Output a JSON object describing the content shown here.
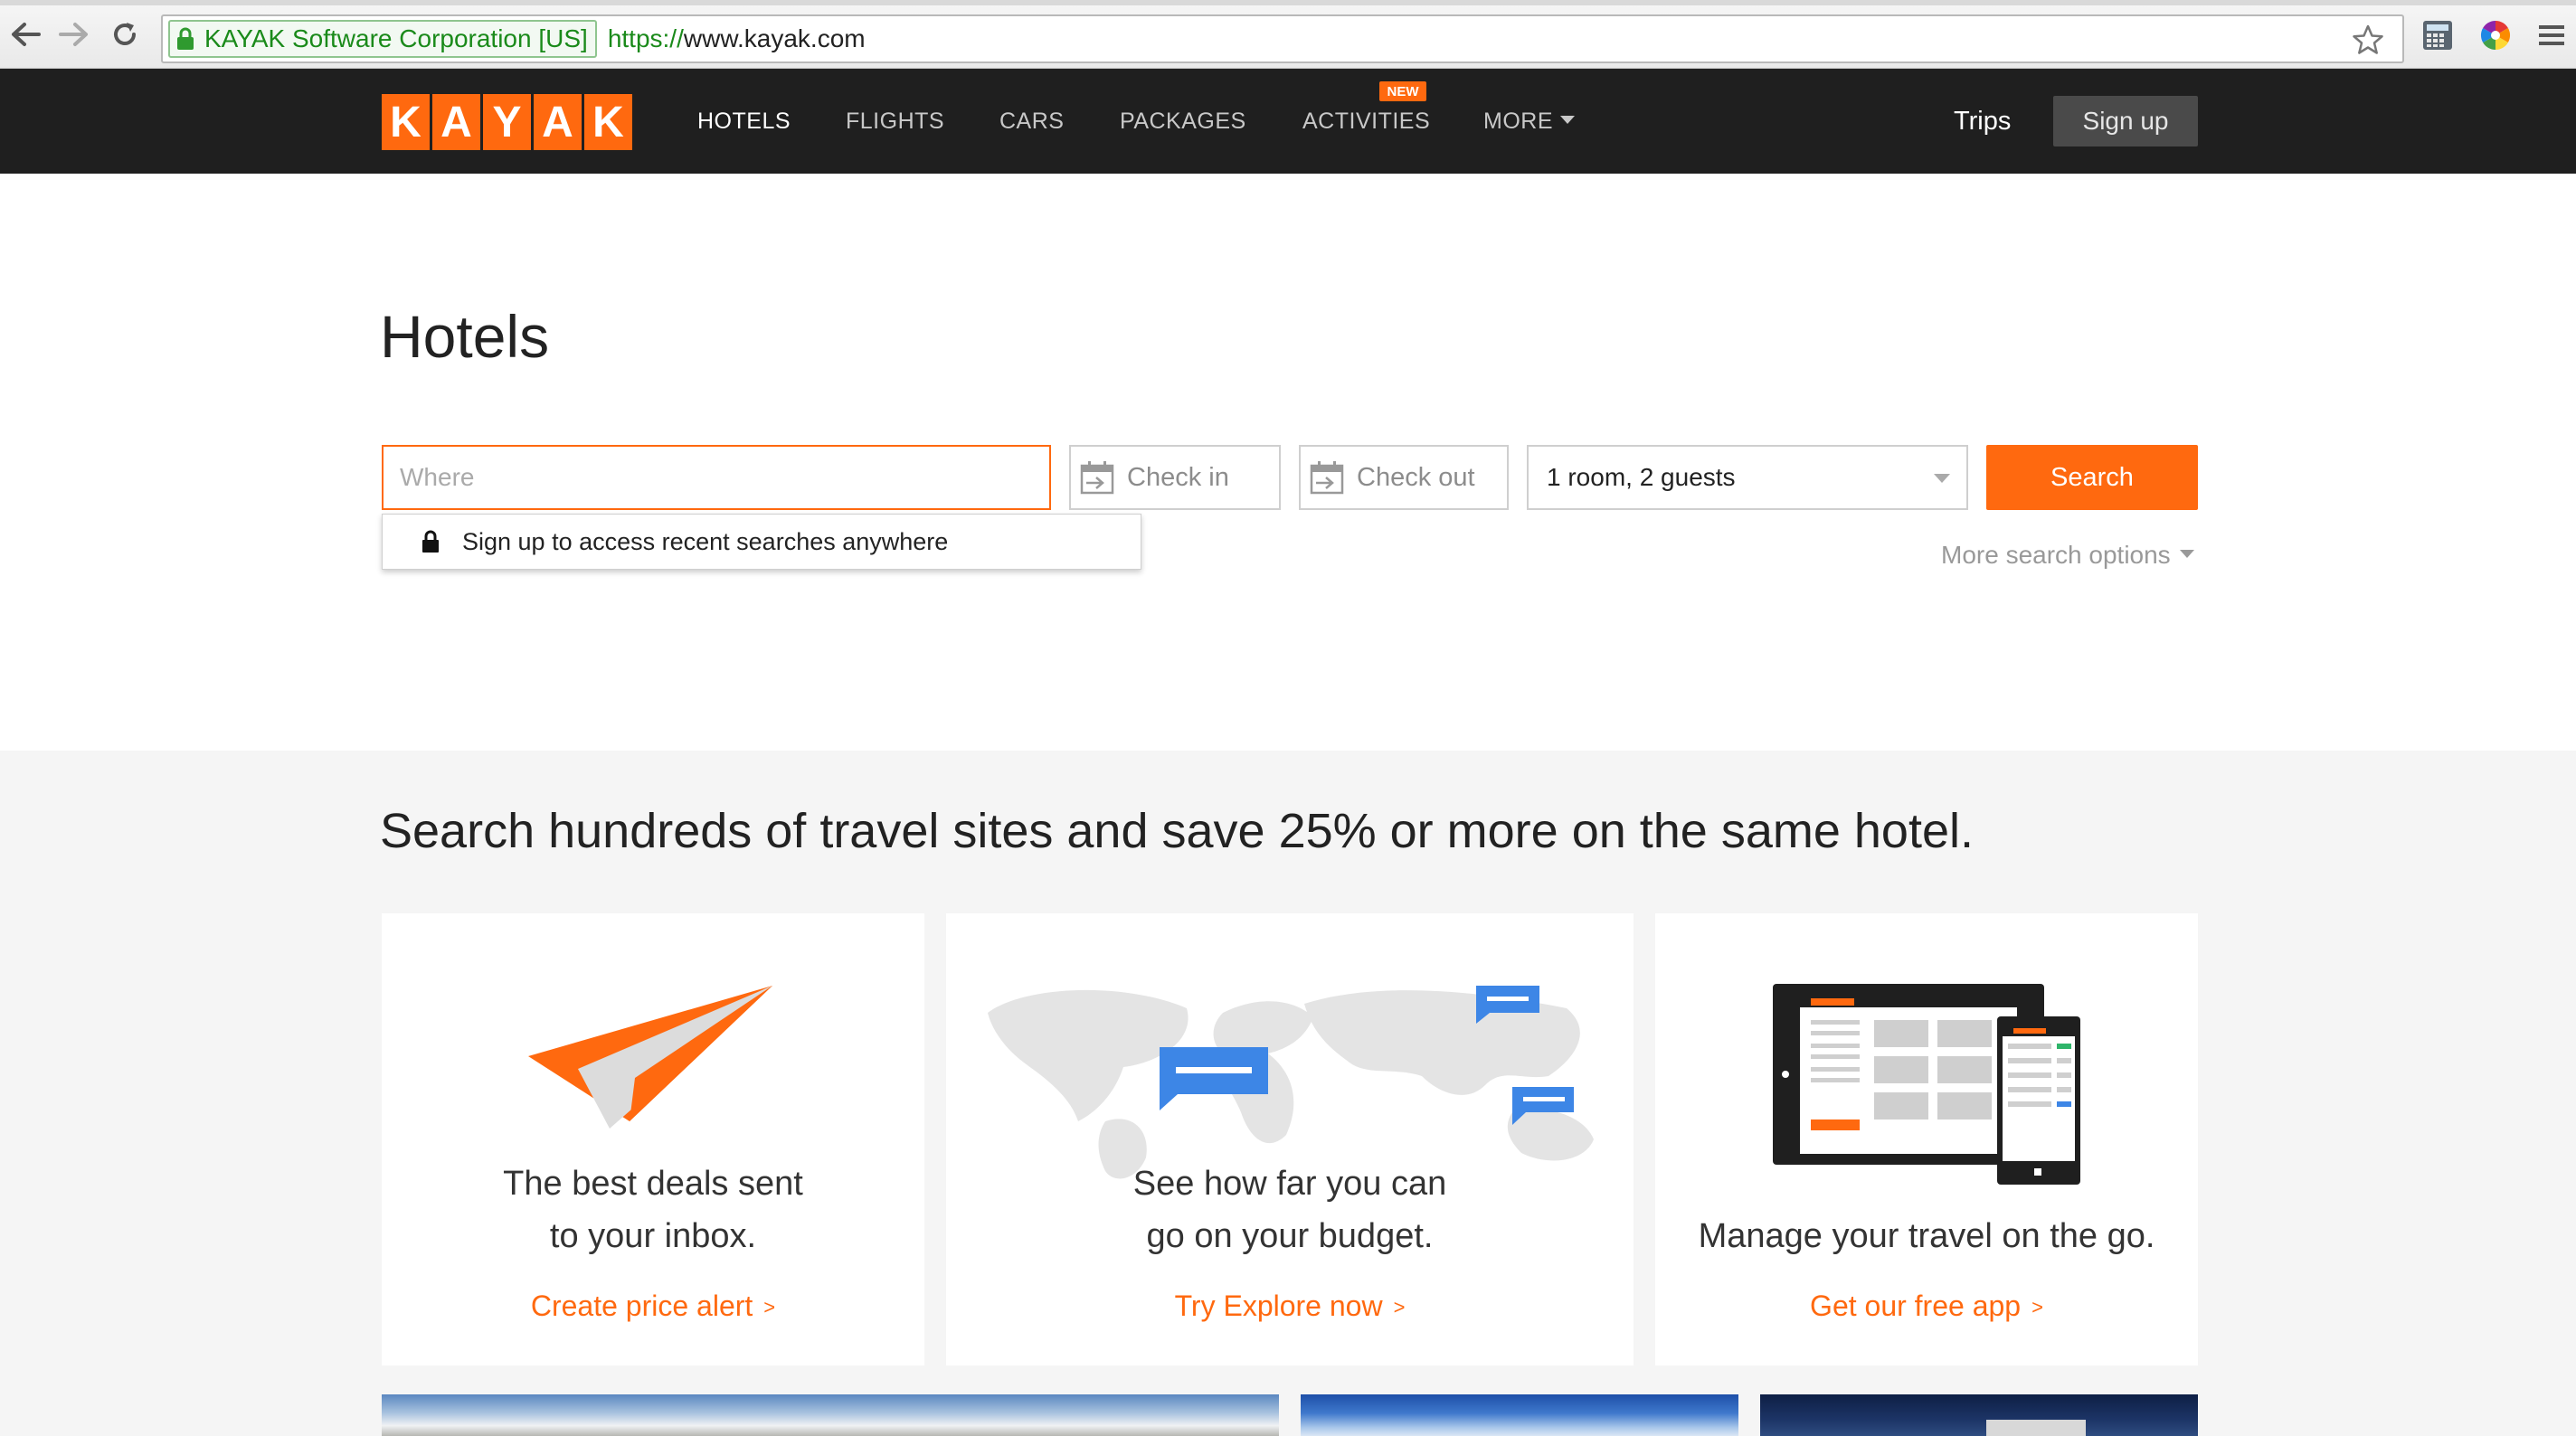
{
  "browser": {
    "ev_label": "KAYAK Software Corporation [US]",
    "url_scheme": "https://",
    "url_rest": "www.kayak.com"
  },
  "header": {
    "logo_letters": [
      "K",
      "A",
      "Y",
      "A",
      "K"
    ],
    "nav": {
      "hotels": "HOTELS",
      "flights": "FLIGHTS",
      "cars": "CARS",
      "packages": "PACKAGES",
      "activities": "ACTIVITIES",
      "more": "MORE"
    },
    "new_badge": "NEW",
    "trips": "Trips",
    "signup": "Sign up"
  },
  "search": {
    "title": "Hotels",
    "where_placeholder": "Where",
    "checkin": "Check in",
    "checkout": "Check out",
    "guests": "1 room, 2 guests",
    "button": "Search",
    "recent_prompt": "Sign up to access recent searches anywhere",
    "more_options": "More search options"
  },
  "promo": {
    "headline": "Search hundreds of travel sites and save 25% or more on the same hotel.",
    "cards": [
      {
        "line1": "The best deals sent",
        "line2": "to your inbox.",
        "link": "Create price alert",
        "icon": "paper-plane-icon"
      },
      {
        "line1": "See how far you can",
        "line2": "go on your budget.",
        "link": "Try Explore now",
        "icon": "world-map-icon"
      },
      {
        "line1": "Manage your travel on the go.",
        "link": "Get our free app",
        "icon": "devices-icon"
      }
    ],
    "link_arrow": ">"
  },
  "colors": {
    "brand_orange": "#ff690f",
    "header_bg": "#1f1f1f",
    "section_bg": "#f5f5f5",
    "map_blue": "#3d86e6"
  }
}
